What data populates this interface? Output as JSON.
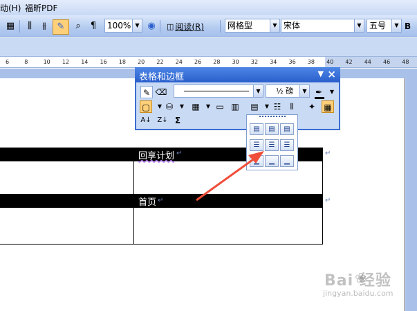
{
  "menubar": {
    "items": [
      "动(H)",
      "福昕PDF"
    ]
  },
  "toolbar": {
    "zoom": "100%",
    "reading_label": "阅读(R)",
    "style_value": "网格型",
    "font_value": "宋体",
    "size_value": "五号"
  },
  "ruler": {
    "numbers": [
      "6",
      "8",
      "10",
      "12",
      "14",
      "16",
      "18",
      "20",
      "22",
      "24",
      "26",
      "28",
      "30",
      "32",
      "34",
      "36",
      "38",
      "40",
      "42",
      "44",
      "46",
      "48"
    ]
  },
  "table": {
    "row1_text": "回享计划",
    "row2_text": "首页"
  },
  "floating_toolbar": {
    "title": "表格和边框",
    "line_weight": "½ 磅"
  },
  "watermark": {
    "brand": "Bai  经验",
    "url": "jingyan.baidu.com"
  },
  "colors": {
    "arrow": "#f04e3a",
    "title_bar": "#2a5fcc",
    "highlight": "#ffd07a"
  }
}
